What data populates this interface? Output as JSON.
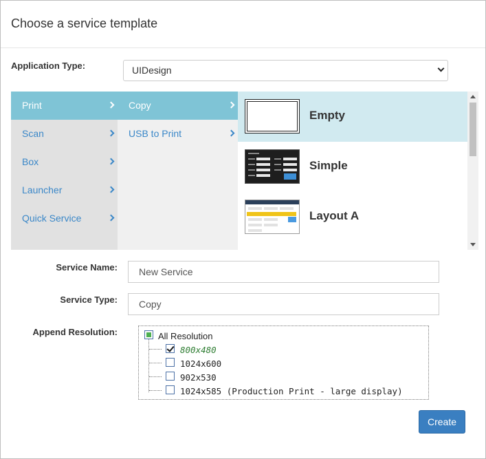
{
  "dialog": {
    "title": "Choose a service template"
  },
  "app_type": {
    "label": "Application Type:",
    "value": "UIDesign"
  },
  "categories": [
    {
      "label": "Print",
      "active": true
    },
    {
      "label": "Scan",
      "active": false
    },
    {
      "label": "Box",
      "active": false
    },
    {
      "label": "Launcher",
      "active": false
    },
    {
      "label": "Quick Service",
      "active": false
    }
  ],
  "subcategories": [
    {
      "label": "Copy",
      "active": true
    },
    {
      "label": "USB to Print",
      "active": false
    }
  ],
  "templates": [
    {
      "name": "Empty",
      "active": true
    },
    {
      "name": "Simple",
      "active": false
    },
    {
      "name": "Layout A",
      "active": false
    }
  ],
  "service_name": {
    "label": "Service Name:",
    "value": "New Service"
  },
  "service_type": {
    "label": "Service Type:",
    "value": "Copy"
  },
  "append_resolution": {
    "label": "Append Resolution:",
    "all_label": "All Resolution",
    "options": [
      {
        "label": "800x480",
        "checked": true
      },
      {
        "label": "1024x600",
        "checked": false
      },
      {
        "label": "902x530",
        "checked": false
      },
      {
        "label": "1024x585 (Production Print - large display)",
        "checked": false
      }
    ]
  },
  "actions": {
    "create_label": "Create"
  },
  "colors": {
    "accent": "#3a7fc1",
    "active_nav": "#7fc4d6",
    "active_template": "#d1eaf0",
    "selected_resolution": "#2e7d32"
  }
}
